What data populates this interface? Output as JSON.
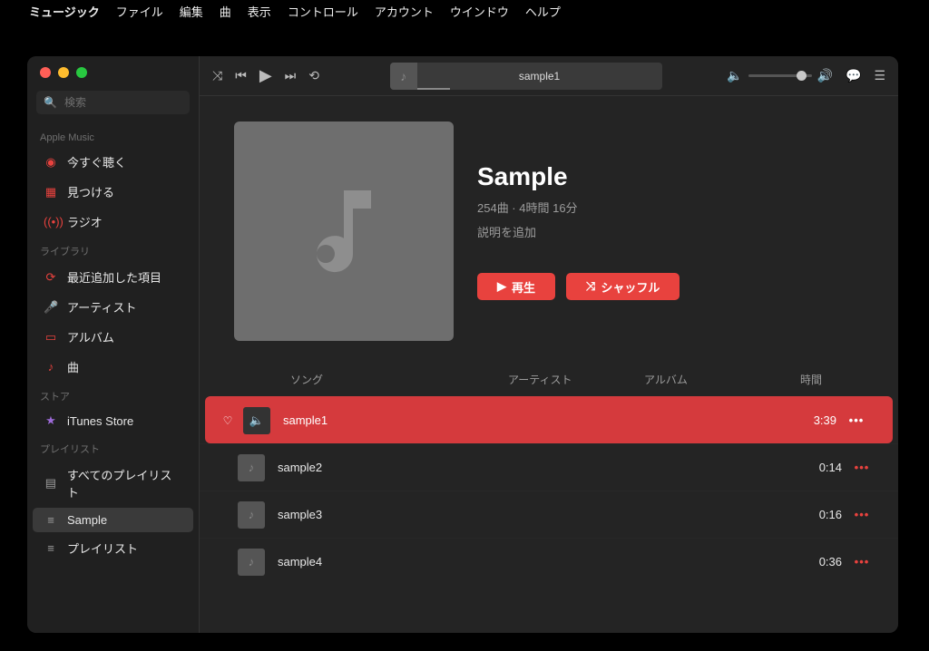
{
  "menubar": {
    "app": "ミュージック",
    "items": [
      "ファイル",
      "編集",
      "曲",
      "表示",
      "コントロール",
      "アカウント",
      "ウインドウ",
      "ヘルプ"
    ]
  },
  "search": {
    "placeholder": "検索"
  },
  "sidebar": {
    "section_apple_music": "Apple Music",
    "section_library": "ライブラリ",
    "section_store": "ストア",
    "section_playlists": "プレイリスト",
    "listen_now": "今すぐ聴く",
    "browse": "見つける",
    "radio": "ラジオ",
    "recently_added": "最近追加した項目",
    "artists": "アーティスト",
    "albums": "アルバム",
    "songs": "曲",
    "itunes_store": "iTunes Store",
    "all_playlists": "すべてのプレイリスト",
    "pl_sample": "Sample",
    "pl_playlist": "プレイリスト"
  },
  "nowplaying": {
    "title": "sample1"
  },
  "playlist": {
    "title": "Sample",
    "subtitle": "254曲 · 4時間 16分",
    "desc_placeholder": "説明を追加",
    "play_label": "再生",
    "shuffle_label": "シャッフル"
  },
  "columns": {
    "song": "ソング",
    "artist": "アーティスト",
    "album": "アルバム",
    "time": "時間"
  },
  "tracks": [
    {
      "name": "sample1",
      "time": "3:39",
      "playing": true
    },
    {
      "name": "sample2",
      "time": "0:14",
      "playing": false
    },
    {
      "name": "sample3",
      "time": "0:16",
      "playing": false
    },
    {
      "name": "sample4",
      "time": "0:36",
      "playing": false
    }
  ]
}
